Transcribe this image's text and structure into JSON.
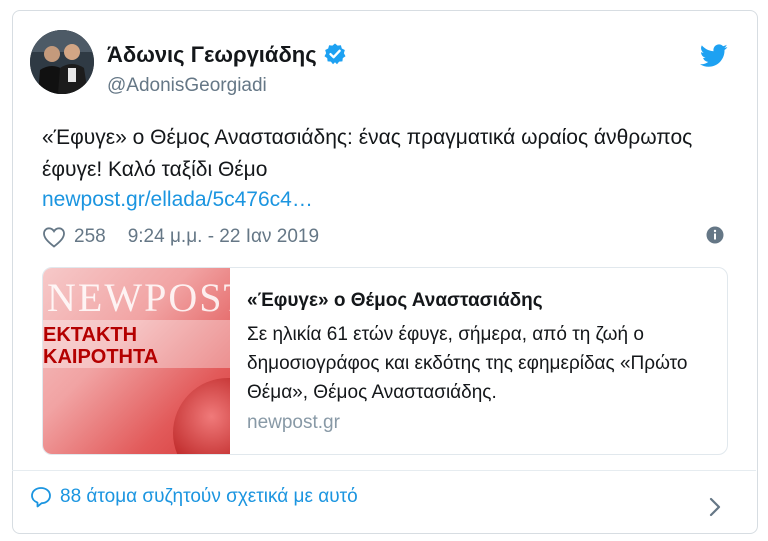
{
  "tweet": {
    "author_name": "Άδωνις Γεωργιάδης",
    "handle": "@AdonisGeorgiadi",
    "text": "«Έφυγε» ο Θέμος Αναστασιάδης: ένας πραγματικά ωραίος άνθρωπος έφυγε! Καλό ταξίδι Θέμο",
    "link": "newpost.gr/ellada/5c476c4…",
    "likes": "258",
    "timestamp": "9:24 μ.μ. - 22 Ιαν 2019"
  },
  "link_card": {
    "title": "«Έφυγε» ο Θέμος Αναστασιάδης",
    "description": "Σε ηλικία 61 ετών έφυγε, σήμερα, από τη ζωή ο δημοσιογράφος και εκδότης της εφημερίδας «Πρώτο Θέμα», Θέμος Αναστασιάδης.",
    "domain": "newpost.gr",
    "thumb_word": "NEWPOST",
    "thumb_line1": "ΕΚΤΑΚΤΗ",
    "thumb_line2": "ΚΑΙΡΟΤΗΤΑ"
  },
  "footer": {
    "discussion": "88 άτομα συζητούν σχετικά με αυτό"
  },
  "icons": {
    "verified": "verified-badge-icon",
    "bird": "twitter-bird-icon",
    "heart": "heart-icon",
    "info": "info-icon",
    "bubble": "reply-bubble-icon",
    "chevron": "chevron-right-icon"
  },
  "colors": {
    "link_blue": "#1b95e0",
    "verified_blue": "#1da1f2",
    "secondary_text": "#657786"
  }
}
